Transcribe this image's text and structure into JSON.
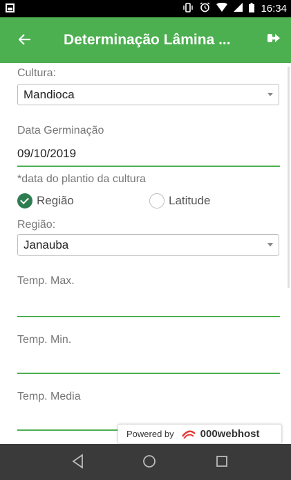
{
  "status_bar": {
    "time": "16:34",
    "icons": [
      "vibrate-icon",
      "alarm-icon",
      "wifi-icon",
      "signal-icon",
      "battery-icon"
    ]
  },
  "app_bar": {
    "title": "Determinação Lâmina ...",
    "back_icon": "arrow-left-icon",
    "logout_icon": "sign-out-icon",
    "color": "#4caf50"
  },
  "form": {
    "cultura": {
      "label": "Cultura:",
      "value": "Mandioca"
    },
    "germinacao": {
      "label": "Data Germinação",
      "value": "09/10/2019",
      "hint": "*data do plantio da cultura"
    },
    "mode": {
      "options": [
        "Região",
        "Latitude"
      ],
      "selected": "Região"
    },
    "regiao": {
      "label": "Região:",
      "value": "Janauba"
    },
    "temp_max": {
      "label": "Temp. Max.",
      "value": ""
    },
    "temp_min": {
      "label": "Temp. Min.",
      "value": ""
    },
    "temp_media": {
      "label": "Temp. Media",
      "value": ""
    }
  },
  "webhost_badge": {
    "prefix": "Powered by",
    "brand": "000webhost"
  },
  "nav_bar": {
    "buttons": [
      "back-triangle-icon",
      "home-circle-icon",
      "recents-square-icon"
    ]
  }
}
